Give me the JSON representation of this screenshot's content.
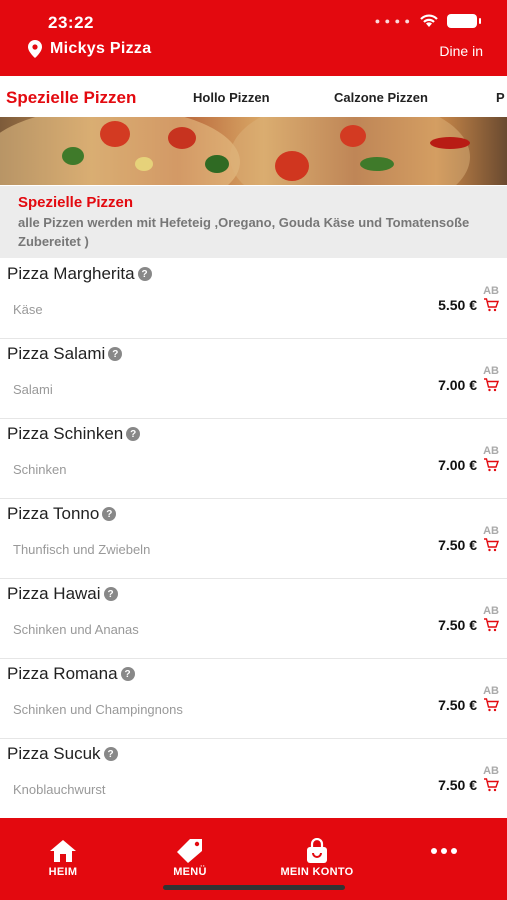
{
  "status_bar": {
    "time": "23:22"
  },
  "header": {
    "store_name": "Mickys Pizza",
    "mode": "Dine in"
  },
  "category_tabs": [
    "Spezielle Pizzen",
    "Hollo Pizzen",
    "Calzone Pizzen",
    "P"
  ],
  "category_info": {
    "title": "Spezielle Pizzen",
    "description": "alle Pizzen werden mit Hefeteig ,Oregano, Gouda Käse und Tomatensoße Zubereitet )"
  },
  "items": [
    {
      "name": "Pizza Margherita",
      "desc": "Käse",
      "ab": "AB",
      "price": "5.50 €"
    },
    {
      "name": "Pizza Salami",
      "desc": "Salami",
      "ab": "AB",
      "price": "7.00 €"
    },
    {
      "name": "Pizza Schinken",
      "desc": "Schinken",
      "ab": "AB",
      "price": "7.00 €"
    },
    {
      "name": "Pizza Tonno",
      "desc": "Thunfisch und Zwiebeln",
      "ab": "AB",
      "price": "7.50 €"
    },
    {
      "name": "Pizza Hawai",
      "desc": "Schinken und Ananas",
      "ab": "AB",
      "price": "7.50 €"
    },
    {
      "name": "Pizza Romana",
      "desc": "Schinken und Champingnons",
      "ab": "AB",
      "price": "7.50 €"
    },
    {
      "name": "Pizza Sucuk",
      "desc": "Knoblauchwurst",
      "ab": "AB",
      "price": "7.50 €"
    }
  ],
  "bottom_nav": [
    "HEIM",
    "MENÜ",
    "MEIN KONTO",
    ""
  ],
  "colors": {
    "brand": "#e3090f"
  }
}
